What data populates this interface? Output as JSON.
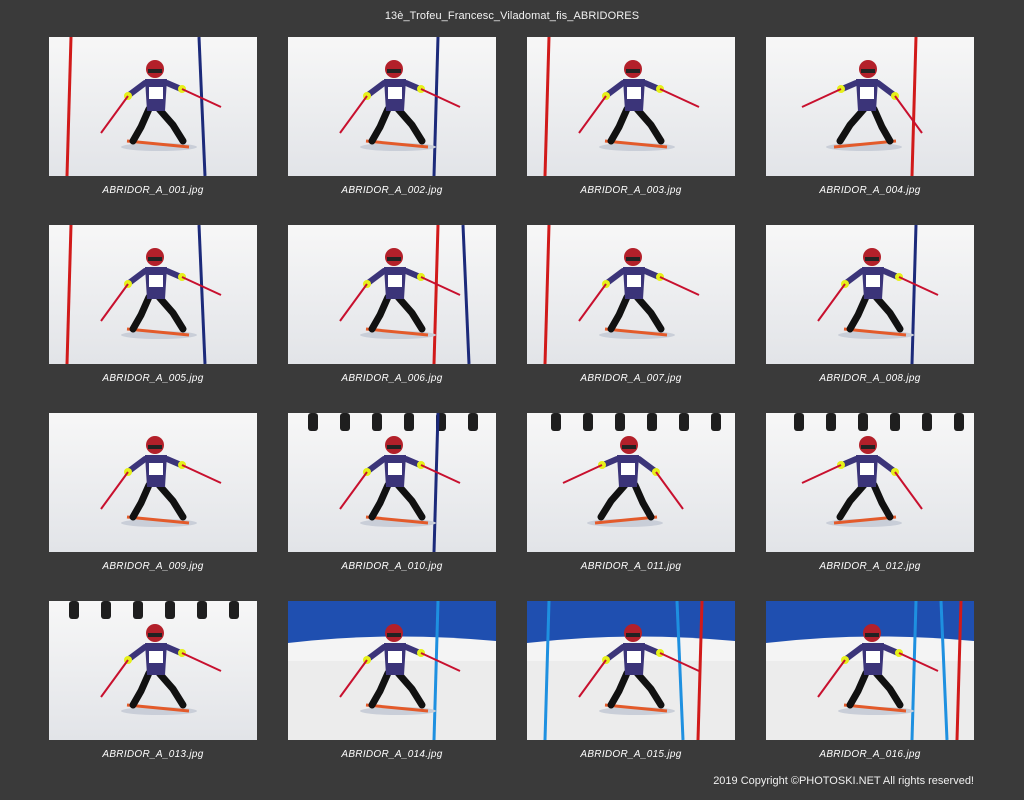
{
  "title": "13è_Trofeu_Francesc_Viladomat_fis_ABRIDORES",
  "copyright": "2019 Copyright ©PHOTOSKI.NET All rights reserved!",
  "photos": [
    {
      "filename": "ABRIDOR_A_001.jpg",
      "sky": false,
      "flip": false,
      "gates": [
        "red",
        "navy"
      ],
      "crowd": false
    },
    {
      "filename": "ABRIDOR_A_002.jpg",
      "sky": false,
      "flip": false,
      "gates": [
        "navy"
      ],
      "crowd": false
    },
    {
      "filename": "ABRIDOR_A_003.jpg",
      "sky": false,
      "flip": false,
      "gates": [
        "red"
      ],
      "crowd": false
    },
    {
      "filename": "ABRIDOR_A_004.jpg",
      "sky": false,
      "flip": true,
      "gates": [
        "red"
      ],
      "crowd": false
    },
    {
      "filename": "ABRIDOR_A_005.jpg",
      "sky": false,
      "flip": false,
      "gates": [
        "red",
        "navy"
      ],
      "crowd": false
    },
    {
      "filename": "ABRIDOR_A_006.jpg",
      "sky": false,
      "flip": false,
      "gates": [
        "red",
        "navy"
      ],
      "crowd": false
    },
    {
      "filename": "ABRIDOR_A_007.jpg",
      "sky": false,
      "flip": false,
      "gates": [
        "red"
      ],
      "crowd": false
    },
    {
      "filename": "ABRIDOR_A_008.jpg",
      "sky": false,
      "flip": false,
      "gates": [
        "navy"
      ],
      "crowd": false
    },
    {
      "filename": "ABRIDOR_A_009.jpg",
      "sky": false,
      "flip": false,
      "gates": [],
      "crowd": false
    },
    {
      "filename": "ABRIDOR_A_010.jpg",
      "sky": false,
      "flip": false,
      "gates": [
        "navy"
      ],
      "crowd": true
    },
    {
      "filename": "ABRIDOR_A_011.jpg",
      "sky": false,
      "flip": true,
      "gates": [],
      "crowd": true
    },
    {
      "filename": "ABRIDOR_A_012.jpg",
      "sky": false,
      "flip": true,
      "gates": [],
      "crowd": true
    },
    {
      "filename": "ABRIDOR_A_013.jpg",
      "sky": false,
      "flip": false,
      "gates": [],
      "crowd": true
    },
    {
      "filename": "ABRIDOR_A_014.jpg",
      "sky": true,
      "flip": false,
      "gates": [
        "blue"
      ],
      "crowd": false
    },
    {
      "filename": "ABRIDOR_A_015.jpg",
      "sky": true,
      "flip": false,
      "gates": [
        "blue",
        "blue",
        "red"
      ],
      "crowd": false
    },
    {
      "filename": "ABRIDOR_A_016.jpg",
      "sky": true,
      "flip": false,
      "gates": [
        "blue",
        "blue",
        "red"
      ],
      "crowd": false
    }
  ],
  "colors": {
    "background": "#3a3a3a",
    "snow": "#ececec",
    "sky": "#1f4fb0",
    "suit": "#3b3479",
    "helmet": "#b3202a",
    "pole_red": "#d11a1a",
    "pole_navy": "#1c2a7a",
    "pole_blue": "#1e90e0",
    "accent_yellow": "#e6f01a"
  }
}
